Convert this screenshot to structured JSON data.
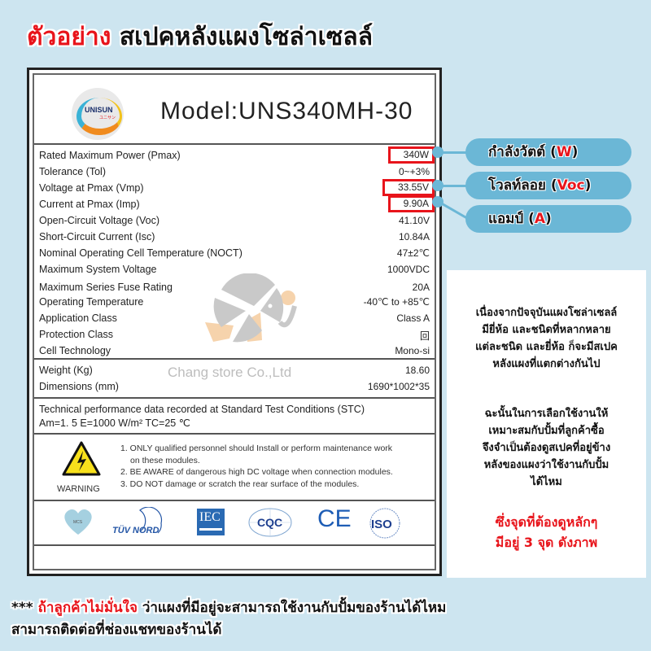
{
  "title": {
    "highlight": "ตัวอย่าง",
    "rest": "สเปคหลังแผงโซล่าเซลล์"
  },
  "label": {
    "brand_logo": {
      "text": "UNISUN",
      "subtext": "ユニサン"
    },
    "model": "Model:UNS340MH-30",
    "specs": [
      {
        "key": "Rated Maximum Power  (Pmax)",
        "value": "340W",
        "highlighted": true
      },
      {
        "key": "Tolerance   (Tol)",
        "value": "0~+3%",
        "highlighted": false
      },
      {
        "key": "Voltage at Pmax  (Vmp)",
        "value": "33.55V",
        "highlighted": true
      },
      {
        "key": "Current at Pmax  (Imp)",
        "value": "9.90A",
        "highlighted": true
      },
      {
        "key": "Open-Circuit Voltage  (Voc)",
        "value": "41.10V",
        "highlighted": false
      },
      {
        "key": "Short-Circuit Current  (Isc)",
        "value": "10.84A",
        "highlighted": false
      },
      {
        "key": "Nominal Operating Cell Temperature  (NOCT)",
        "value": "47±2℃",
        "highlighted": false
      },
      {
        "key": "Maximum System Voltage",
        "value": "1000VDC",
        "highlighted": false
      },
      {
        "key": "Maximum Series Fuse Rating",
        "value": "20A",
        "highlighted": false
      },
      {
        "key": "Operating Temperature",
        "value": "-40℃ to +85℃",
        "highlighted": false
      },
      {
        "key": "Application  Class",
        "value": "Class A",
        "highlighted": false
      },
      {
        "key": "Protection Class",
        "value": "回",
        "highlighted": false
      },
      {
        "key": "Cell Technology",
        "value": "Mono-si",
        "highlighted": false
      }
    ],
    "physical": [
      {
        "key": "Weight  (Kg)",
        "value": "18.60"
      },
      {
        "key": "Dimensions  (mm)",
        "value": "1690*1002*35"
      }
    ],
    "watermark": "Chang store Co.,Ltd",
    "stc": {
      "line1": "Technical performance data recorded at Standard Test Conditions  (STC)",
      "line2": "Am=1. 5    E=1000 W/m²   TC=25 ℃"
    },
    "warning": {
      "label": "WARNING",
      "items": [
        "1. ONLY qualified personnel should Install or perform maintenance work",
        "on these modules.",
        "2. BE AWARE of dangerous high DC voltage  when connection modules.",
        "3. DO NOT damage or scratch the rear surface  of the modules."
      ]
    },
    "certifications": [
      "MCS",
      "TÜV NORD",
      "IEC",
      "CQC",
      "CE",
      "ISO"
    ]
  },
  "callouts": [
    {
      "text": "กำลังวัตต์ ",
      "unit": "W"
    },
    {
      "text": "โวลท์ลอย ",
      "unit": "Voc"
    },
    {
      "text": "แอมป์ ",
      "unit": "A"
    }
  ],
  "note": {
    "paragraph1": [
      "เนื่องจากปัจจุบันแผงโซล่าเซลล์",
      "มียี่ห้อ และชนิดที่หลากหลาย",
      "แต่ละชนิด และยี่ห้อ ก็จะมีสเปค",
      "หลังแผงที่แตกต่างกันไป"
    ],
    "paragraph2": [
      "ฉะนั้นในการเลือกใช้งานให้",
      "เหมาะสมกับปั้มที่ลูกค้าซื้อ",
      "จึงจำเป็นต้องดูสเปคที่อยู่ข้าง",
      "หลังของแผงว่าใช้งานกับปั้ม",
      "ได้ไหม"
    ],
    "emphasis": [
      "ซึ่งจุดที่ต้องดูหลักๆ",
      "มีอยู่ 3 จุด ดังภาพ"
    ]
  },
  "footer": {
    "prefix": "*** ",
    "highlight": "ถ้าลูกค้าไม่มั่นใจ",
    "line1_rest": " ว่าแผงที่มีอยู่จะสามารถใช้งานกับปั้มของร้านได้ไหม",
    "line2": "สามารถติดต่อที่ช่องแชทของร้านได้"
  },
  "colors": {
    "background": "#cde5f0",
    "accent_red": "#e8141b",
    "callout_blue": "#6bb7d6"
  }
}
